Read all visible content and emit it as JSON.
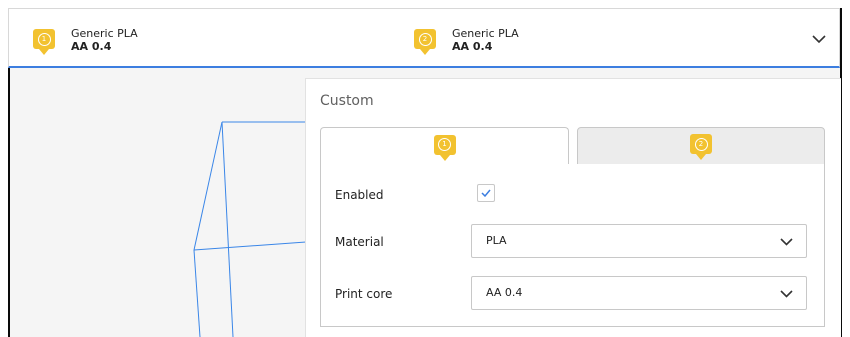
{
  "header": {
    "extruders": [
      {
        "number": "1",
        "material": "Generic PLA",
        "core": "AA 0.4"
      },
      {
        "number": "2",
        "material": "Generic PLA",
        "core": "AA 0.4"
      }
    ],
    "collapse_icon": "chevron-down-icon"
  },
  "panel": {
    "title": "Custom",
    "tabs": [
      {
        "number": "1",
        "active": true
      },
      {
        "number": "2",
        "active": false
      }
    ],
    "enabled_label": "Enabled",
    "enabled_checked": true,
    "material_label": "Material",
    "material_value": "PLA",
    "core_label": "Print core",
    "core_value": "AA 0.4"
  },
  "colors": {
    "accent_blue": "#3c7ee0",
    "badge_yellow": "#f2c230",
    "wireframe_blue": "#3a86e8"
  }
}
